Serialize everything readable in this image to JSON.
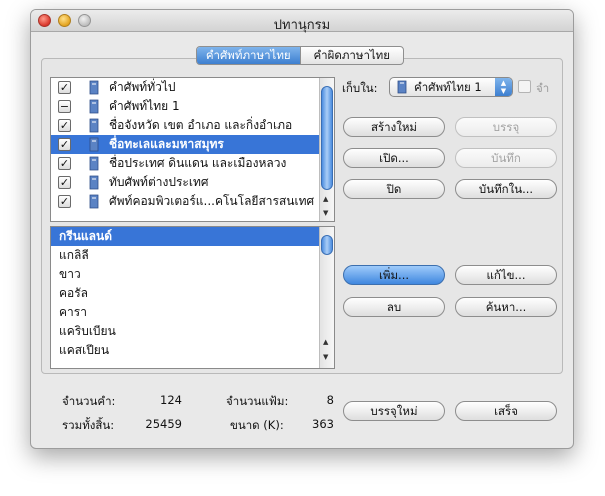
{
  "window": {
    "title": "ปทานุกรม"
  },
  "tabs": [
    {
      "label": "คำศัพท์ภาษาไทย",
      "active": true
    },
    {
      "label": "คำผิดภาษาไทย",
      "active": false
    }
  ],
  "dictionaries": [
    {
      "label": "คำศัพท์ทั่วไป",
      "check": "✓",
      "selected": false
    },
    {
      "label": "คำศัพท์ไทย 1",
      "check": "−",
      "selected": false
    },
    {
      "label": "ชื่อจังหวัด เขต อำเภอ และกิ่งอำเภอ",
      "check": "✓",
      "selected": false
    },
    {
      "label": "ชื่อทะเลและมหาสมุทร",
      "check": "✓",
      "selected": true
    },
    {
      "label": "ชื่อประเทศ ดินแดน และเมืองหลวง",
      "check": "✓",
      "selected": false
    },
    {
      "label": "ทับศัพท์ต่างประเทศ",
      "check": "✓",
      "selected": false
    },
    {
      "label": "ศัพท์คอมพิวเตอร์แ...คโนโลยีสารสนเทศ",
      "check": "✓",
      "selected": false
    }
  ],
  "words": [
    {
      "label": "กรีนแลนด์",
      "selected": true
    },
    {
      "label": "แกลิลี",
      "selected": false
    },
    {
      "label": "ขาว",
      "selected": false
    },
    {
      "label": "คอรัล",
      "selected": false
    },
    {
      "label": "คารา",
      "selected": false
    },
    {
      "label": "แคริบเบียน",
      "selected": false
    },
    {
      "label": "แคสเปียน",
      "selected": false
    }
  ],
  "save_in": {
    "label": "เก็บใน:",
    "value": "คำศัพท์ไทย 1",
    "checkbox_label": "จำ"
  },
  "buttons": {
    "new": "สร้างใหม่",
    "load": "บรรจุ",
    "open": "เปิด...",
    "save": "บันทึก",
    "close": "ปิด",
    "save_as": "บันทึกใน...",
    "add": "เพิ่ม...",
    "edit": "แก้ไข...",
    "delete": "ลบ",
    "search": "ค้นหา...",
    "reload": "บรรจุใหม่",
    "done": "เสร็จ"
  },
  "stats": {
    "word_count_label": "จำนวนคำ:",
    "word_count": "124",
    "file_count_label": "จำนวนแฟ้ม:",
    "file_count": "8",
    "total_label": "รวมทั้งสิ้น:",
    "total": "25459",
    "size_label": "ขนาด (K):",
    "size": "363"
  },
  "colors": {
    "selection": "#3875d7",
    "accent": "#3d7fd0"
  }
}
